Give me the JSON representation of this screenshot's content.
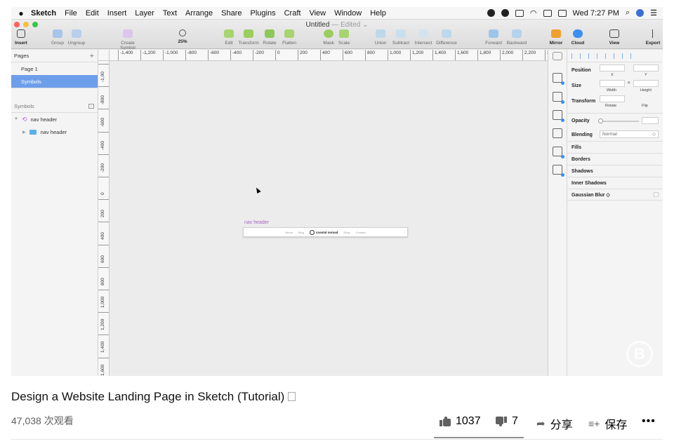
{
  "menubar": {
    "app": "Sketch",
    "items": [
      "File",
      "Edit",
      "Insert",
      "Layer",
      "Text",
      "Arrange",
      "Share",
      "Plugins",
      "Craft",
      "View",
      "Window",
      "Help"
    ],
    "clock": "Wed 7:27 PM"
  },
  "document": {
    "title": "Untitled",
    "status": "— Edited ⌄"
  },
  "toolbar": {
    "insert": "Insert",
    "group": "Group",
    "ungroup": "Ungroup",
    "create_symbol": "Create Symbol",
    "zoom_value": "25%",
    "edit": "Edit",
    "transform": "Transform",
    "rotate": "Rotate",
    "flatten": "Flatten",
    "mask": "Mask",
    "scale": "Scale",
    "union": "Union",
    "subtract": "Subtract",
    "intersect": "Intersect",
    "difference": "Difference",
    "forward": "Forward",
    "backward": "Backward",
    "mirror": "Mirror",
    "cloud": "Cloud",
    "view": "View",
    "export": "Export"
  },
  "pages": {
    "header": "Pages",
    "items": [
      "Page 1",
      "Symbols"
    ]
  },
  "layers": {
    "header": "Symbols",
    "items": [
      {
        "label": "nav header"
      },
      {
        "label": "nav header"
      }
    ]
  },
  "ruler": {
    "h_ticks": [
      "-1,400",
      "-1,200",
      "-1,000",
      "-800",
      "-600",
      "-400",
      "-200",
      "0",
      "200",
      "400",
      "600",
      "800",
      "1,000",
      "1,200",
      "1,400",
      "1,600",
      "1,800",
      "2,000",
      "2,200",
      "2"
    ],
    "v_ticks": [
      "-1,00",
      "-800",
      "-600",
      "-400",
      "-200",
      "0",
      "200",
      "400",
      "600",
      "800",
      "1,000",
      "1,200",
      "1,400",
      "1,600"
    ]
  },
  "artboard": {
    "label": "nav header",
    "nav_links": [
      "About",
      "Blog",
      "Shop",
      "Contact"
    ],
    "logo_text": "coastal nomad"
  },
  "inspector": {
    "position": "Position",
    "x": "X",
    "y": "Y",
    "size": "Size",
    "width": "Width",
    "height": "Height",
    "transform": "Transform",
    "rotate": "Rotate",
    "flip": "Flip",
    "opacity": "Opacity",
    "blending": "Blending",
    "blending_value": "Normal",
    "fills": "Fills",
    "borders": "Borders",
    "shadows": "Shadows",
    "inner_shadows": "Inner Shadows",
    "gaussian_blur": "Gaussian Blur ◇"
  },
  "video": {
    "title": "Design a Website Landing Page in Sketch (Tutorial)",
    "views": "47,038 次观看",
    "likes": "1037",
    "dislikes": "7",
    "share": "分享",
    "save": "保存",
    "more": "•••"
  },
  "colors": {
    "selected_page": "#6d9eea",
    "symbol_purple": "#a863c9",
    "accent_blue": "#3a8ff0"
  }
}
